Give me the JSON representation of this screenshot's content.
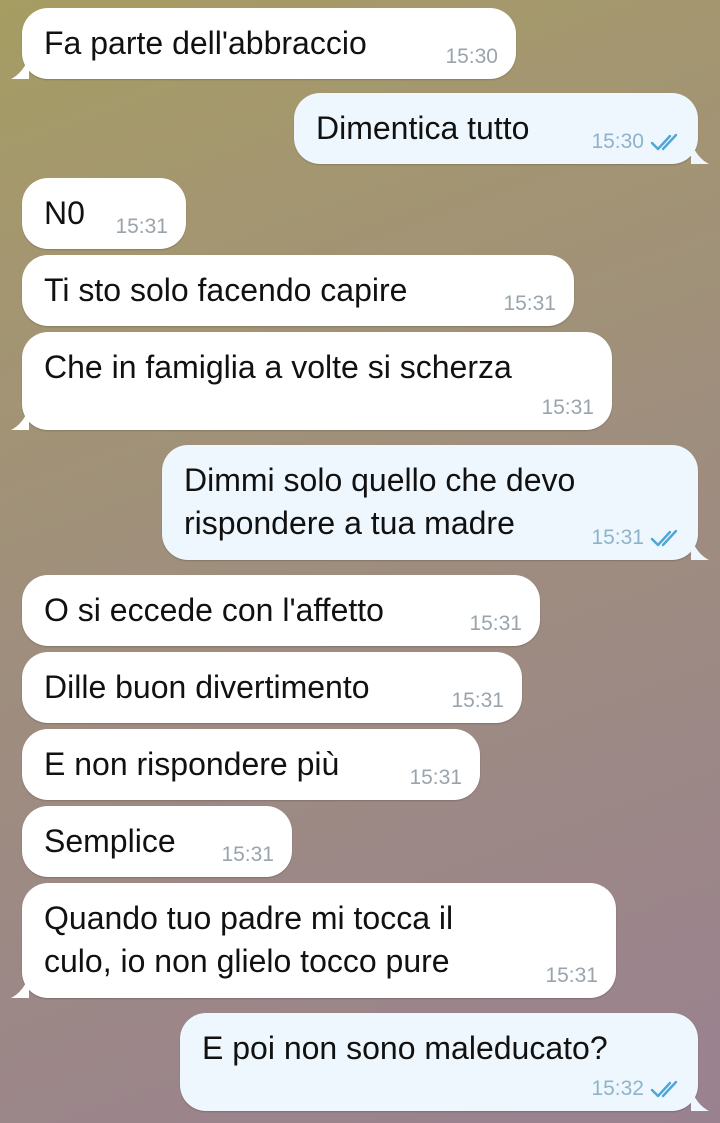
{
  "colors": {
    "incoming_bubble": "#ffffff",
    "outgoing_bubble": "#eef7fd",
    "time_text": "#9aa4ac",
    "read_checks": "#4ea6d8"
  },
  "messages": [
    {
      "direction": "in",
      "text": "Fa parte dell'abbraccio",
      "time": "15:30"
    },
    {
      "direction": "out",
      "text": "Dimentica tutto",
      "time": "15:30",
      "status": "double-check-icon"
    },
    {
      "direction": "in",
      "text": "N0",
      "time": "15:31"
    },
    {
      "direction": "in",
      "text": "Ti sto solo facendo capire",
      "time": "15:31"
    },
    {
      "direction": "in",
      "text": "Che in famiglia a volte si scherza",
      "time": "15:31"
    },
    {
      "direction": "out",
      "text": "Dimmi solo quello che devo\nrispondere a tua madre",
      "time": "15:31",
      "status": "double-check-icon"
    },
    {
      "direction": "in",
      "text": "O si eccede con l'affetto",
      "time": "15:31"
    },
    {
      "direction": "in",
      "text": "Dille buon divertimento",
      "time": "15:31"
    },
    {
      "direction": "in",
      "text": "E non rispondere più",
      "time": "15:31"
    },
    {
      "direction": "in",
      "text": "Semplice",
      "time": "15:31"
    },
    {
      "direction": "in",
      "text": "Quando tuo padre mi tocca il\nculo, io non glielo tocco pure",
      "time": "15:31"
    },
    {
      "direction": "out",
      "text": "E poi non sono maleducato?",
      "time": "15:32",
      "status": "double-check-icon"
    }
  ]
}
